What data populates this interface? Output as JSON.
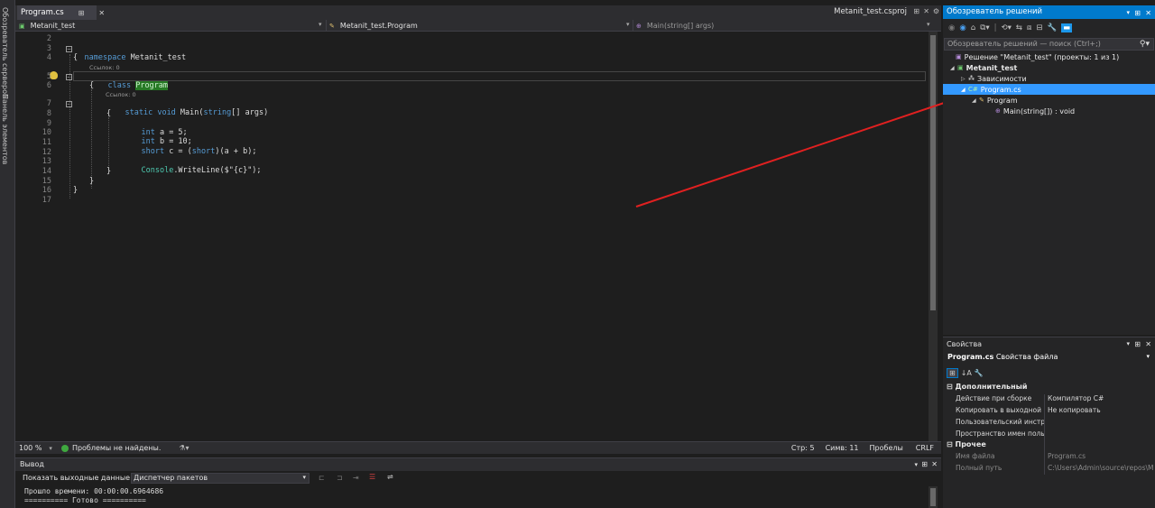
{
  "rail": {
    "tab1": "Обозреватель серверов",
    "tab2": "Панель элементов"
  },
  "editor": {
    "active_tab": "Program.cs",
    "project_tab": "Metanit_test.csproj",
    "nav": {
      "project": "Metanit_test",
      "class": "Metanit_test.Program",
      "member": "Main(string[] args)"
    },
    "codelens": "Ссылок: 0",
    "line_numbers": [
      "2",
      "3",
      "4",
      "5",
      "6",
      "7",
      "8",
      "9",
      "10",
      "11",
      "12",
      "13",
      "14",
      "15",
      "16",
      "17"
    ],
    "code": {
      "ns_kw": "namespace",
      "ns_name": " Metanit_test",
      "brace_open": "{",
      "class_kw": "class",
      "class_name": "Program",
      "static_kw": "static",
      "void_kw": "void",
      "main_rest": " Main(",
      "string_kw": "string",
      "args_rest": "[] args)",
      "int_kw": "int",
      "line9_rest": " a = 5;",
      "line10_rest": " b = 10;",
      "short_kw": "short",
      "line11_mid": " c = (",
      "line11_end": ")(a + b);",
      "console_ty": "Console",
      "line13_rest": ".WriteLine($\"{c}\");",
      "brace_close": "}"
    }
  },
  "status": {
    "zoom": "100 %",
    "issues": "Проблемы не найдены.",
    "line": "Стр: 5",
    "col": "Симв: 11",
    "spaces": "Пробелы",
    "eol": "CRLF"
  },
  "output": {
    "title": "Вывод",
    "show_label": "Показать выходные данные из:",
    "source": "Диспетчер пакетов",
    "lines": [
      "Прошло времени: 00:00:00.6964686",
      "========== Готово =========="
    ]
  },
  "solution": {
    "title": "Обозреватель решений",
    "search_placeholder": "Обозреватель решений — поиск (Ctrl+;)",
    "items": [
      {
        "label": "Решение \"Metanit_test\" (проекты: 1 из 1)"
      },
      {
        "label": "Metanit_test"
      },
      {
        "label": "Зависимости"
      },
      {
        "label": "Program.cs"
      },
      {
        "label": "Program"
      },
      {
        "label": "Main(string[]) : void"
      }
    ]
  },
  "properties": {
    "title": "Свойства",
    "object": "Program.cs",
    "object_type": "Свойства файла",
    "cat1": "Дополнительный",
    "rows1": [
      {
        "key": "Действие при сборке",
        "val": "Компилятор C#"
      },
      {
        "key": "Копировать в выходной ка",
        "val": "Не копировать"
      },
      {
        "key": "Пользовательский инстру",
        "val": ""
      },
      {
        "key": "Пространство имен польз",
        "val": ""
      }
    ],
    "cat2": "Прочее",
    "rows2": [
      {
        "key": "Имя файла",
        "val": "Program.cs"
      },
      {
        "key": "Полный путь",
        "val": "C:\\Users\\Admin\\source\\repos\\M"
      }
    ]
  },
  "colors": {
    "accent": "#007acc",
    "selection": "#3399ff",
    "arrow": "#e02020",
    "keyword": "#569cd6",
    "type": "#4ec9b0"
  }
}
